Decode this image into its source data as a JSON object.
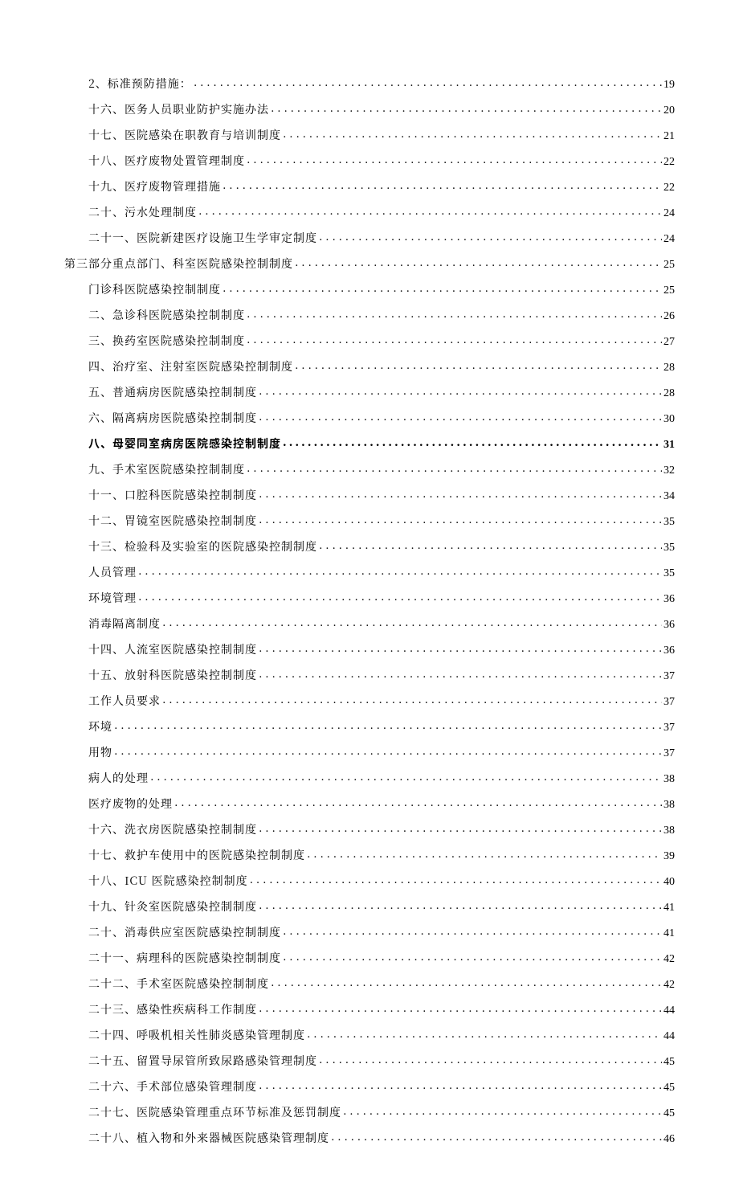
{
  "toc": [
    {
      "indent": 1,
      "bold": false,
      "title": "2、标准预防措施：",
      "page": "19"
    },
    {
      "indent": 1,
      "bold": false,
      "title": "十六、医务人员职业防护实施办法",
      "page": "20"
    },
    {
      "indent": 1,
      "bold": false,
      "title": "十七、医院感染在职教育与培训制度",
      "page": "21"
    },
    {
      "indent": 1,
      "bold": false,
      "title": "十八、医疗废物处置管理制度",
      "page": "22"
    },
    {
      "indent": 1,
      "bold": false,
      "title": "十九、医疗废物管理措施",
      "page": "22"
    },
    {
      "indent": 1,
      "bold": false,
      "title": "二十、污水处理制度",
      "page": "24"
    },
    {
      "indent": 1,
      "bold": false,
      "title": "二十一、医院新建医疗设施卫生学审定制度",
      "page": "24"
    },
    {
      "indent": 0,
      "bold": false,
      "title": "第三部分重点部门、科室医院感染控制制度",
      "page": "25"
    },
    {
      "indent": 1,
      "bold": false,
      "title": "门诊科医院感染控制制度",
      "page": "25"
    },
    {
      "indent": 1,
      "bold": false,
      "title": "二、急诊科医院感染控制制度",
      "page": "26"
    },
    {
      "indent": 1,
      "bold": false,
      "title": "三、换药室医院感染控制制度",
      "page": "27"
    },
    {
      "indent": 1,
      "bold": false,
      "title": "四、治疗室、注射室医院感染控制制度",
      "page": "28"
    },
    {
      "indent": 1,
      "bold": false,
      "title": "五、普通病房医院感染控制制度",
      "page": "28"
    },
    {
      "indent": 1,
      "bold": false,
      "title": "六、隔离病房医院感染控制制度",
      "page": "30"
    },
    {
      "indent": 1,
      "bold": true,
      "title": "八、母婴同室病房医院感染控制制度",
      "page": "31"
    },
    {
      "indent": 1,
      "bold": false,
      "title": "九、手术室医院感染控制制度",
      "page": "32"
    },
    {
      "indent": 1,
      "bold": false,
      "title": "十一、口腔科医院感染控制制度",
      "page": "34"
    },
    {
      "indent": 1,
      "bold": false,
      "title": "十二、胃镜室医院感染控制制度",
      "page": "35"
    },
    {
      "indent": 1,
      "bold": false,
      "title": "十三、检验科及实验室的医院感染控制制度",
      "page": "35"
    },
    {
      "indent": 1,
      "bold": false,
      "title": "人员管理",
      "page": "35"
    },
    {
      "indent": 1,
      "bold": false,
      "title": "环境管理",
      "page": "36"
    },
    {
      "indent": 1,
      "bold": false,
      "title": "消毒隔离制度",
      "page": "36"
    },
    {
      "indent": 1,
      "bold": false,
      "title": "十四、人流室医院感染控制制度",
      "page": "36"
    },
    {
      "indent": 1,
      "bold": false,
      "title": "十五、放射科医院感染控制制度",
      "page": "37"
    },
    {
      "indent": 1,
      "bold": false,
      "title": "工作人员要求",
      "page": "37"
    },
    {
      "indent": 1,
      "bold": false,
      "title": "环境",
      "page": "37"
    },
    {
      "indent": 1,
      "bold": false,
      "title": "用物",
      "page": "37"
    },
    {
      "indent": 1,
      "bold": false,
      "title": "病人的处理",
      "page": "38"
    },
    {
      "indent": 1,
      "bold": false,
      "title": "医疗废物的处理",
      "page": "38"
    },
    {
      "indent": 1,
      "bold": false,
      "title": "十六、洗衣房医院感染控制制度",
      "page": "38"
    },
    {
      "indent": 1,
      "bold": false,
      "title": "十七、救护车使用中的医院感染控制制度",
      "page": "39"
    },
    {
      "indent": 1,
      "bold": false,
      "title": "十八、ICU 医院感染控制制度",
      "page": "40"
    },
    {
      "indent": 1,
      "bold": false,
      "title": "十九、针灸室医院感染控制制度",
      "page": "41"
    },
    {
      "indent": 1,
      "bold": false,
      "title": "二十、消毒供应室医院感染控制制度",
      "page": "41"
    },
    {
      "indent": 1,
      "bold": false,
      "title": "二十一、病理科的医院感染控制制度",
      "page": "42"
    },
    {
      "indent": 1,
      "bold": false,
      "title": "二十二、手术室医院感染控制制度",
      "page": "42"
    },
    {
      "indent": 1,
      "bold": false,
      "title": "二十三、感染性疾病科工作制度",
      "page": "44"
    },
    {
      "indent": 1,
      "bold": false,
      "title": "二十四、呼吸机相关性肺炎感染管理制度",
      "page": "44"
    },
    {
      "indent": 1,
      "bold": false,
      "title": "二十五、留置导尿管所致尿路感染管理制度",
      "page": "45"
    },
    {
      "indent": 1,
      "bold": false,
      "title": "二十六、手术部位感染管理制度",
      "page": "45"
    },
    {
      "indent": 1,
      "bold": false,
      "title": "二十七、医院感染管理重点环节标准及惩罚制度",
      "page": "45"
    },
    {
      "indent": 1,
      "bold": false,
      "title": "二十八、植入物和外来器械医院感染管理制度",
      "page": "46"
    }
  ]
}
